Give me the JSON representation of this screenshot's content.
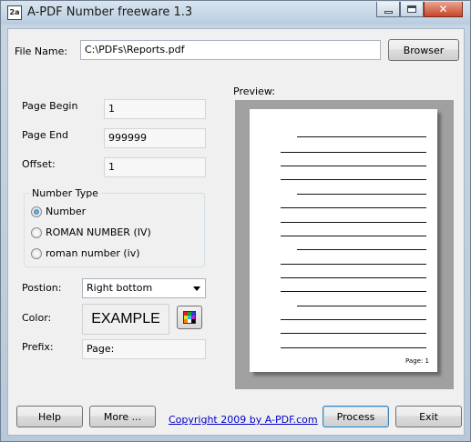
{
  "window": {
    "title": "A-PDF Number freeware 1.3",
    "icon_text": "2a",
    "buttons": [
      "minimize-icon",
      "maximize-icon",
      "close-icon"
    ]
  },
  "file": {
    "label": "File Name:",
    "value": "C:\\PDFs\\Reports.pdf",
    "browse_label": "Browser"
  },
  "fields": {
    "page_begin_label": "Page Begin",
    "page_begin_value": "1",
    "page_end_label": "Page End",
    "page_end_value": "999999",
    "offset_label": "Offset:",
    "offset_value": "1"
  },
  "number_type": {
    "title": "Number Type",
    "options": [
      {
        "label": "Number",
        "checked": true
      },
      {
        "label": "ROMAN NUMBER (IV)",
        "checked": false
      },
      {
        "label": "roman number (iv)",
        "checked": false
      }
    ]
  },
  "position": {
    "label": "Postion:",
    "selected": "Right bottom"
  },
  "color": {
    "label": "Color:",
    "example_text": "EXAMPLE",
    "picker_icon": "color-palette-icon"
  },
  "prefix": {
    "label": "Prefix:",
    "value": "Page:"
  },
  "preview": {
    "label": "Preview:",
    "page_number_text": "Page: 1"
  },
  "footer": {
    "help_label": "Help",
    "more_label": "More ...",
    "copyright_text": "Copyright 2009 by A-PDF.com",
    "process_label": "Process",
    "exit_label": "Exit"
  },
  "colors": {
    "link": "#0000cc",
    "default_button_border": "#3c7fb1",
    "preview_background": "#a0a0a0"
  }
}
